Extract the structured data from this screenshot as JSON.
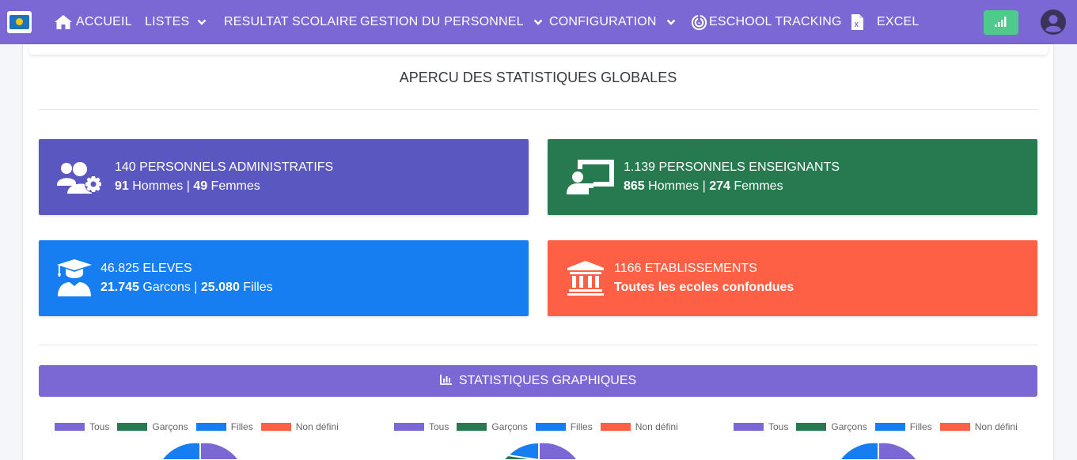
{
  "nav": {
    "home": "ACCUEIL",
    "lists": "LISTES",
    "results": "RESULTAT SCOLAIRE",
    "staff": "GESTION DU PERSONNEL",
    "config": "CONFIGURATION",
    "tracking": "ESCHOOL TRACKING",
    "excel": "EXCEL"
  },
  "page_title": "APERCU DES STATISTIQUES GLOBALES",
  "stats": {
    "admin": {
      "title": "140 PERSONNELS ADMINISTRATIFS",
      "men": "91",
      "men_label": " Hommes | ",
      "women": "49",
      "women_label": " Femmes",
      "color": "#5b57c0"
    },
    "teachers": {
      "title": "1.139 PERSONNELS ENSEIGNANTS",
      "men": "865",
      "men_label": " Hommes | ",
      "women": "274",
      "women_label": " Femmes",
      "color": "#277a4f"
    },
    "students": {
      "title": "46.825 ELEVES",
      "boys": "21.745",
      "boys_label": " Garcons | ",
      "girls": "25.080",
      "girls_label": " Filles",
      "color": "#167ef0"
    },
    "schools": {
      "title": "1166 ETABLISSEMENTS",
      "subtitle": "Toutes les ecoles confondues",
      "color": "#fe6046"
    }
  },
  "graphs": {
    "header": "STATISTIQUES GRAPHIQUES",
    "legend": [
      "Tous",
      "Garçons",
      "Filles",
      "Non défini"
    ],
    "legend_colors": [
      "#7b68d4",
      "#277a4f",
      "#167ef0",
      "#fe6046"
    ]
  },
  "colors": {
    "navbar": "#7b68d4",
    "signal": "#4ecb8c"
  },
  "icons": {
    "home": "home-icon",
    "chevron": "chevron-down-icon",
    "tracking": "radar-icon",
    "excel": "excel-file-icon",
    "signal": "signal-icon",
    "avatar": "user-circle-icon",
    "admin": "users-cog-icon",
    "teacher": "chalkboard-teacher-icon",
    "student": "graduate-icon",
    "school": "institution-icon",
    "chart": "bar-chart-icon"
  }
}
